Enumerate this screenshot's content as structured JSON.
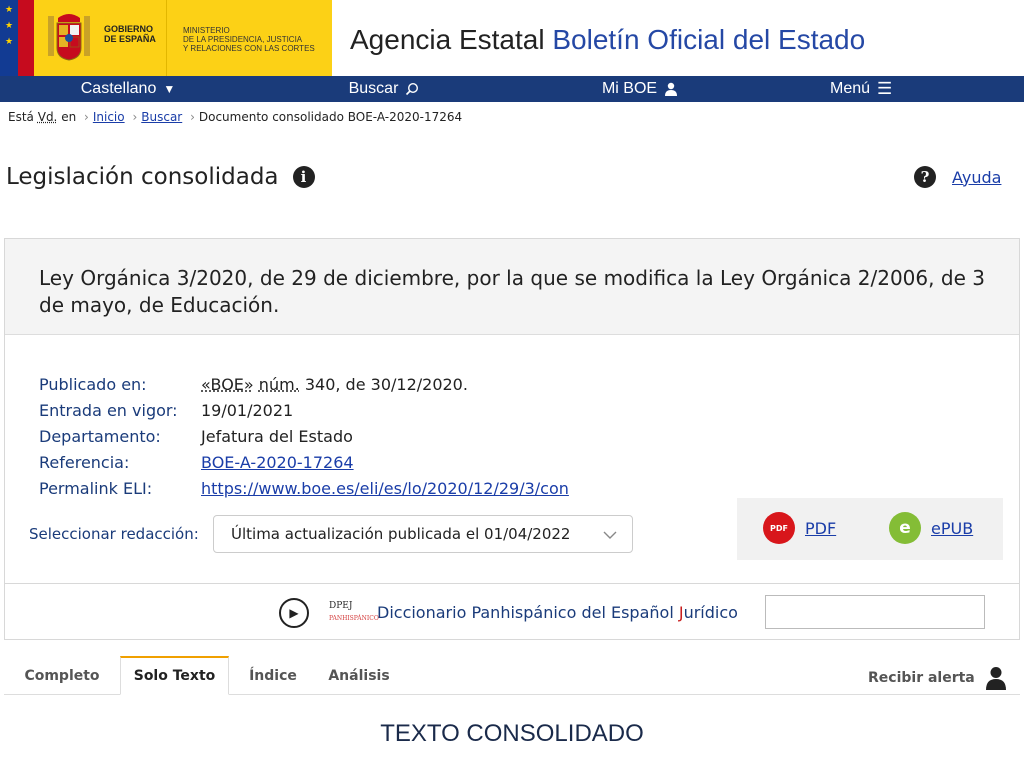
{
  "header": {
    "gobierno_line1": "GOBIERNO",
    "gobierno_line2": "DE ESPAÑA",
    "ministerio_line1": "MINISTERIO",
    "ministerio_line2": "DE LA PRESIDENCIA, JUSTICIA",
    "ministerio_line3": "Y RELACIONES CON LAS CORTES",
    "agency_prefix": "Agencia Estatal",
    "agency_name": "Boletín Oficial del Estado"
  },
  "nav": {
    "language": "Castellano",
    "search": "Buscar",
    "my_boe": "Mi BOE",
    "menu": "Menú"
  },
  "breadcrumb": {
    "prefix": "Está",
    "prefix_abbr": "Vd.",
    "prefix_suffix": "en",
    "home": "Inicio",
    "search": "Buscar",
    "current": "Documento consolidado BOE-A-2020-17264"
  },
  "page": {
    "title": "Legislación consolidada",
    "help": "Ayuda"
  },
  "document": {
    "title": "Ley Orgánica 3/2020, de 29 de diciembre, por la que se modifica la Ley Orgánica 2/2006, de 3 de mayo, de Educación.",
    "published_label": "Publicado en:",
    "published_boe": "«BOE»",
    "published_num_abbr": "núm.",
    "published_rest": "340, de 30/12/2020.",
    "entry_label": "Entrada en vigor:",
    "entry_value": "19/01/2021",
    "department_label": "Departamento:",
    "department_value": "Jefatura del Estado",
    "reference_label": "Referencia:",
    "reference_value": "BOE-A-2020-17264",
    "permalink_label": "Permalink ELI:",
    "permalink_value": "https://www.boe.es/eli/es/lo/2020/12/29/3/con"
  },
  "redaction": {
    "label": "Seleccionar redacción:",
    "selected": "Última actualización publicada el 01/04/2022"
  },
  "downloads": {
    "pdf": "PDF",
    "pdf_icon_text": "PDF",
    "epub": "ePUB"
  },
  "dictionary": {
    "logo_main": "DPEJ",
    "logo_sub": "PANHISPÁNICO",
    "text_before": "Diccionario Panhispánico del Español ",
    "text_red": "J",
    "text_after": "urídico",
    "input_value": ""
  },
  "tabs": [
    {
      "label": "Completo"
    },
    {
      "label": "Solo Texto"
    },
    {
      "label": "Índice"
    },
    {
      "label": "Análisis"
    }
  ],
  "alert": {
    "label": "Recibir alerta"
  },
  "section": {
    "title": "TEXTO CONSOLIDADO"
  },
  "colors": {
    "nav_bg": "#1a3b7a",
    "gov_yellow": "#fcd116",
    "link": "#1a3da8",
    "tab_accent": "#f0a000"
  }
}
